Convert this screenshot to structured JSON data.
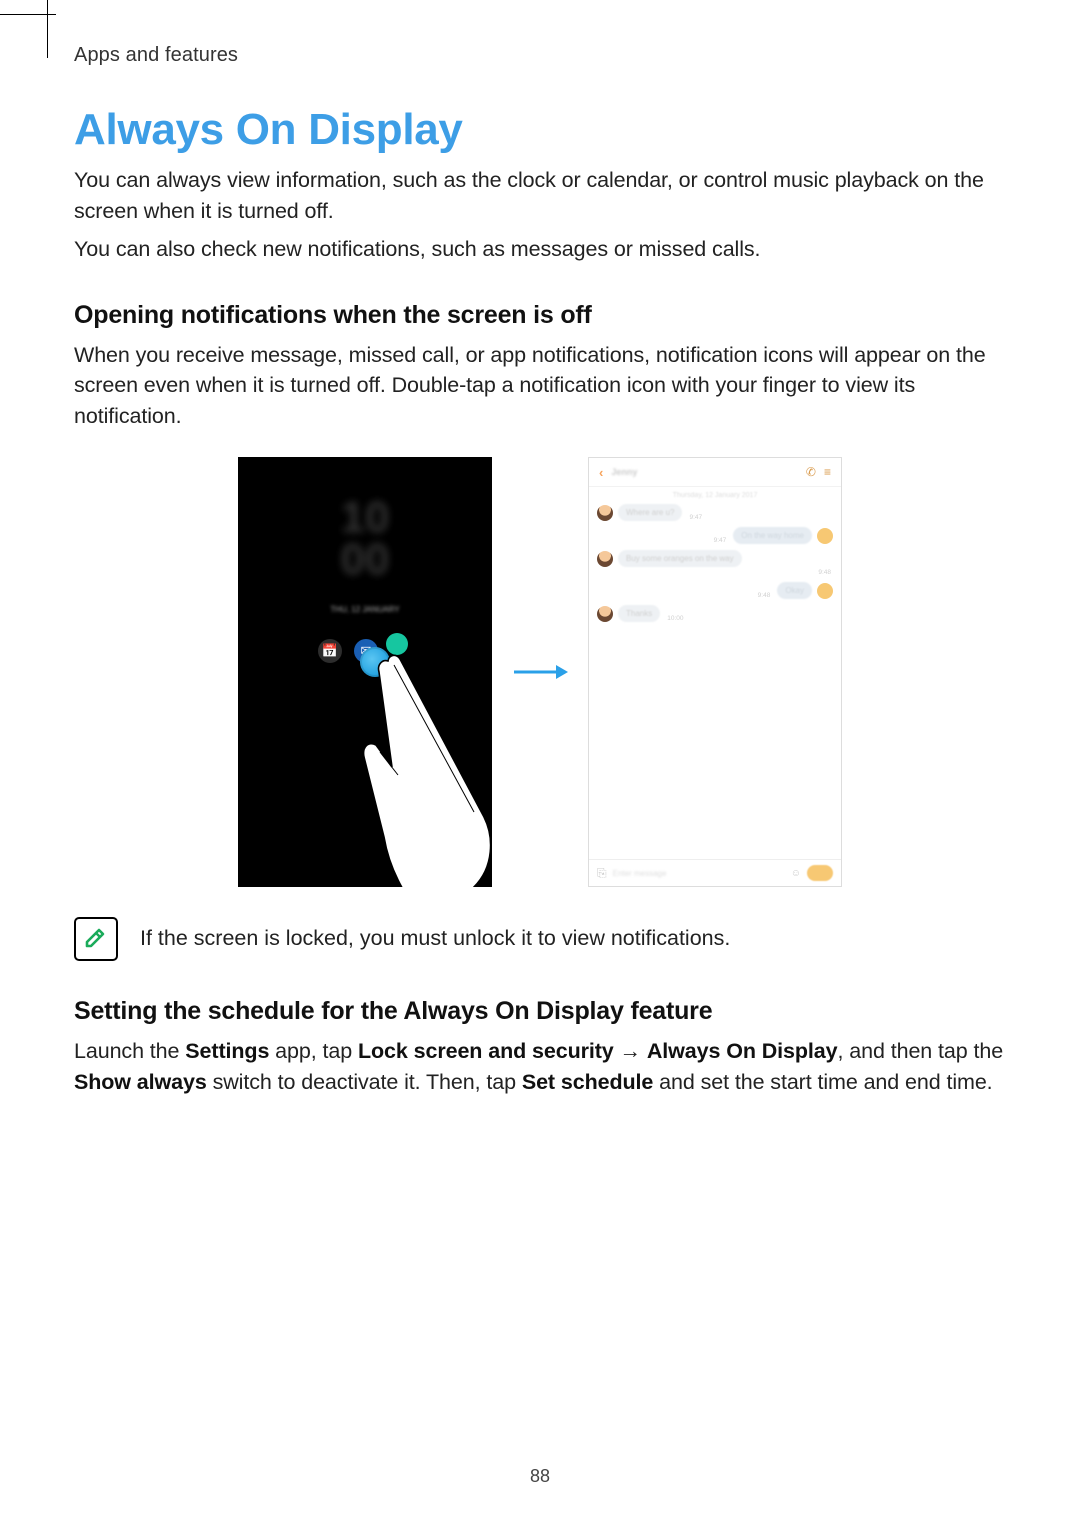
{
  "breadcrumb": "Apps and features",
  "title": "Always On Display",
  "intro_p1": "You can always view information, such as the clock or calendar, or control music playback on the screen when it is turned off.",
  "intro_p2": "You can also check new notifications, such as messages or missed calls.",
  "section1": {
    "heading": "Opening notifications when the screen is off",
    "body": "When you receive message, missed call, or app notifications, notification icons will appear on the screen even when it is turned off. Double-tap a notification icon with your finger to view its notification."
  },
  "aod": {
    "time_top": "10",
    "time_bottom": "00",
    "date_line": "THU, 12 JANUARY"
  },
  "chat": {
    "contact": "Jenny",
    "date": "Thursday, 12 January 2017",
    "m1": {
      "text": "Where are u?",
      "time": "9:47"
    },
    "m2": {
      "text": "On the way home",
      "time": "9:47"
    },
    "m3": {
      "text": "Buy some oranges on the way",
      "time": "9:48"
    },
    "m4": {
      "text": "Okay",
      "time": "9:48"
    },
    "m5": {
      "text": "Thanks",
      "time": "10:00"
    },
    "placeholder": "Enter message"
  },
  "note_text": "If the screen is locked, you must unlock it to view notifications.",
  "section2": {
    "heading": "Setting the schedule for the Always On Display feature",
    "body_parts": {
      "p1": "Launch the ",
      "b1": "Settings",
      "p2": " app, tap ",
      "b2": "Lock screen and security",
      "arrow": " → ",
      "b3": "Always On Display",
      "p3": ", and then tap the ",
      "b4": "Show always",
      "p4": " switch to deactivate it. Then, tap ",
      "b5": "Set schedule",
      "p5": " and set the start time and end time."
    }
  },
  "page_number": "88"
}
